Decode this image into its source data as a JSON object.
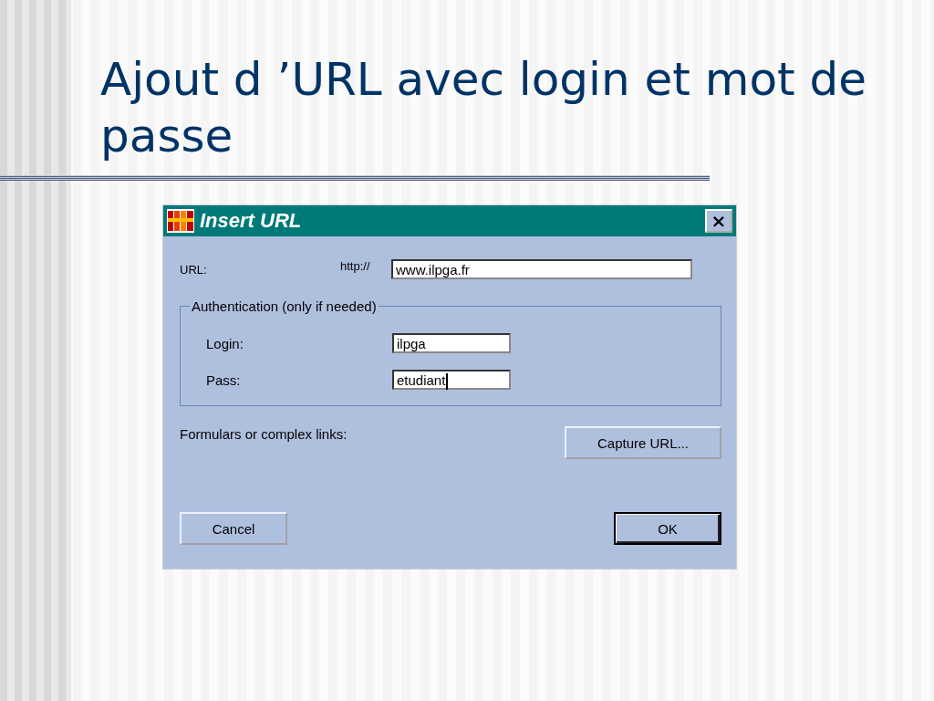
{
  "slide": {
    "title": "Ajout d ’URL avec login et mot de passe"
  },
  "dialog": {
    "title": "Insert URL",
    "close": "×",
    "url": {
      "label": "URL:",
      "prefix": "http://",
      "value": "www.ilpga.fr",
      "focused": false
    },
    "group": {
      "legend": "Authentication (only if needed)",
      "fields": [
        {
          "label": "Login:",
          "value": "ilpga",
          "focused": false
        },
        {
          "label": "Pass:",
          "value": "etudiant",
          "focused": true
        }
      ]
    },
    "complex": {
      "label": "Formulars or complex links:",
      "button": "Capture URL..."
    },
    "buttons": [
      {
        "label": "Cancel",
        "default": false
      },
      {
        "label": "OK",
        "default": true
      }
    ]
  }
}
